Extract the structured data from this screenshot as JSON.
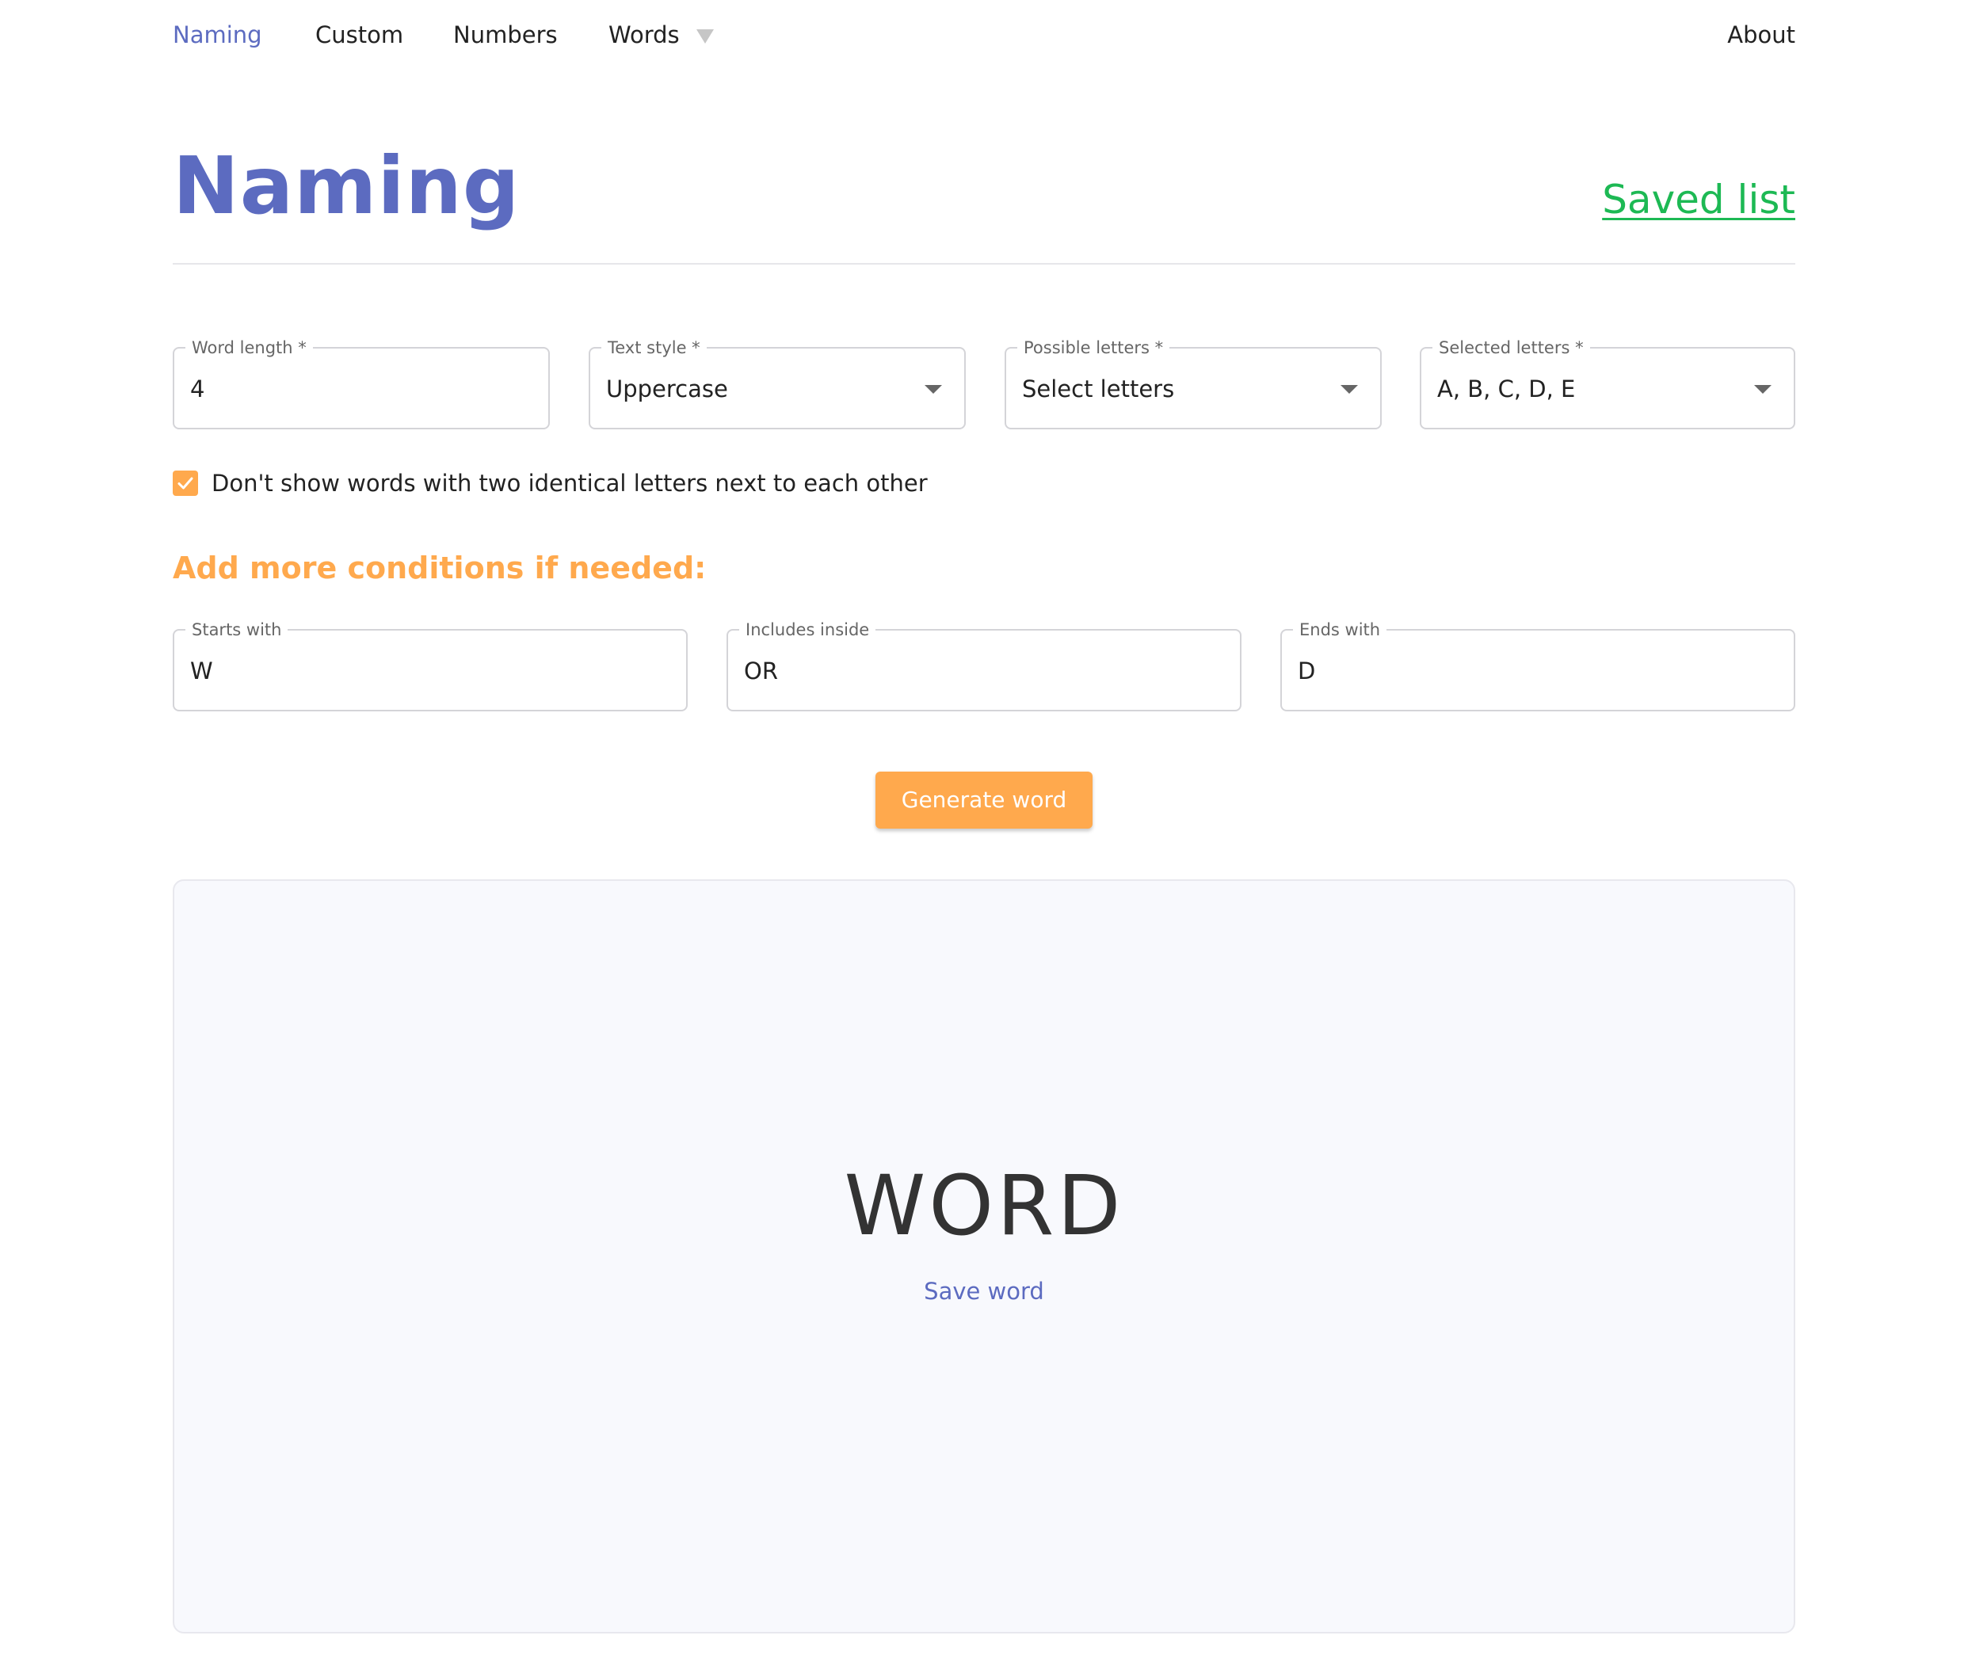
{
  "nav": {
    "items": [
      {
        "label": "Naming"
      },
      {
        "label": "Custom"
      },
      {
        "label": "Numbers"
      },
      {
        "label": "Words"
      }
    ],
    "about_label": "About"
  },
  "header": {
    "title": "Naming",
    "saved_list_label": "Saved list"
  },
  "form": {
    "word_length": {
      "label": "Word length *",
      "value": "4"
    },
    "text_style": {
      "label": "Text style *",
      "value": "Uppercase"
    },
    "possible_letters": {
      "label": "Possible letters *",
      "value": "Select letters"
    },
    "selected_letters": {
      "label": "Selected letters *",
      "value": "A, B, C, D, E"
    },
    "no_double_letters": {
      "label": "Don't show words with two identical letters next to each other",
      "checked": true
    }
  },
  "conditions": {
    "heading": "Add more conditions if needed:",
    "starts_with": {
      "label": "Starts with",
      "value": "W"
    },
    "includes_inside": {
      "label": "Includes inside",
      "value": "OR"
    },
    "ends_with": {
      "label": "Ends with",
      "value": "D"
    }
  },
  "actions": {
    "generate_label": "Generate word"
  },
  "result": {
    "word": "WORD",
    "save_label": "Save word"
  },
  "colors": {
    "primary": "#5c6bc0",
    "accent": "#ffa94d",
    "link": "#1db954",
    "panel_bg": "#f8f9fd"
  }
}
